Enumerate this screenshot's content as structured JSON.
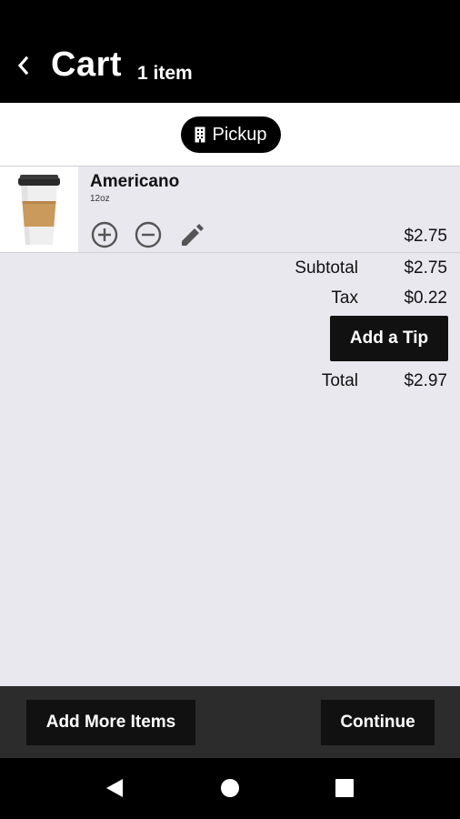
{
  "header": {
    "title": "Cart",
    "item_count": "1 item",
    "back_icon": "chevron-left-icon"
  },
  "order_mode": {
    "label": "Pickup",
    "icon": "building-icon"
  },
  "cart_items": [
    {
      "name": "Americano",
      "size": "12oz",
      "price": "$2.75",
      "image": "coffee-cup-icon",
      "controls": [
        "plus-circle-icon",
        "minus-circle-icon",
        "pencil-icon"
      ]
    }
  ],
  "totals": {
    "subtotal_label": "Subtotal",
    "subtotal_value": "$2.75",
    "tax_label": "Tax",
    "tax_value": "$0.22",
    "tip_button": "Add a Tip",
    "total_label": "Total",
    "total_value": "$2.97"
  },
  "actions": {
    "add_more": "Add More Items",
    "continue": "Continue"
  },
  "colors": {
    "header_bg": "#000000",
    "page_bg": "#e9e8ef",
    "button_bg": "#111111",
    "action_bar_bg": "#2c2c2c"
  }
}
